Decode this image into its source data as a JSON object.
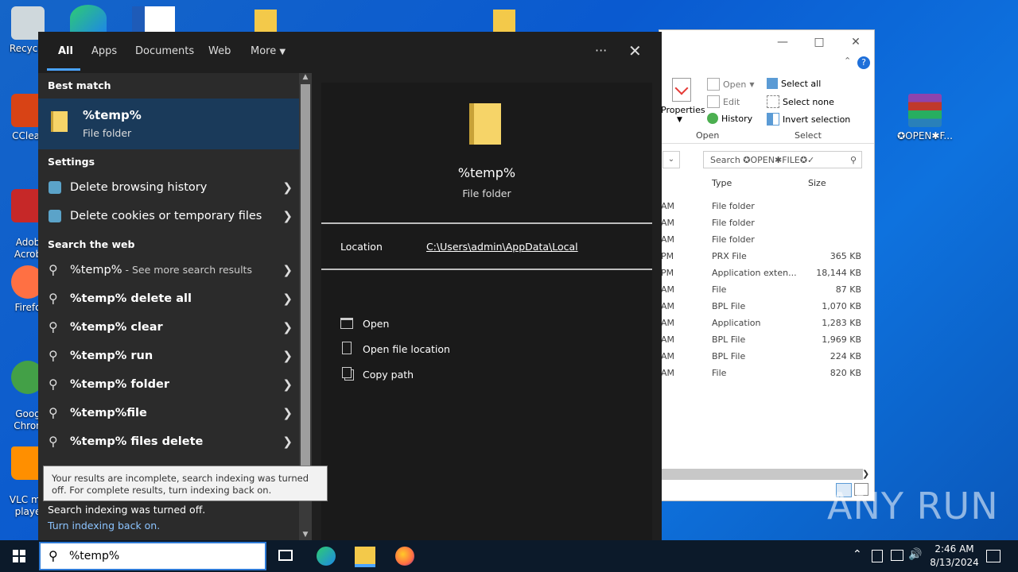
{
  "desktop": {
    "icons": [
      {
        "label": "Recycle",
        "color": "#cfd8dc"
      },
      {
        "label": "CClear",
        "color": "#d84315"
      },
      {
        "label": "Adob\nAcrob",
        "color": "#c62828"
      },
      {
        "label": "Firefo",
        "color": "#ff7043"
      },
      {
        "label": "Goog\nChron",
        "color": "#43a047"
      },
      {
        "label": "VLC me\nplaye",
        "color": "#ff8f00"
      }
    ],
    "right_icon_label": "✪OPEN✱F..."
  },
  "explorer": {
    "ribbon": {
      "properties": "Properties",
      "open": "Open",
      "edit": "Edit",
      "history": "History",
      "select_all": "Select all",
      "select_none": "Select none",
      "invert_selection": "Invert selection",
      "group_open": "Open",
      "group_select": "Select"
    },
    "search_placeholder": "Search ✪OPEN✱FILE✪✓",
    "columns": {
      "type": "Type",
      "size": "Size"
    },
    "rows": [
      {
        "date": "AM",
        "type": "File folder",
        "size": ""
      },
      {
        "date": "AM",
        "type": "File folder",
        "size": ""
      },
      {
        "date": "AM",
        "type": "File folder",
        "size": ""
      },
      {
        "date": "PM",
        "type": "PRX File",
        "size": "365 KB"
      },
      {
        "date": "PM",
        "type": "Application exten...",
        "size": "18,144 KB"
      },
      {
        "date": "AM",
        "type": "File",
        "size": "87 KB"
      },
      {
        "date": "AM",
        "type": "BPL File",
        "size": "1,070 KB"
      },
      {
        "date": "AM",
        "type": "Application",
        "size": "1,283 KB"
      },
      {
        "date": "AM",
        "type": "BPL File",
        "size": "1,969 KB"
      },
      {
        "date": "AM",
        "type": "BPL File",
        "size": "224 KB"
      },
      {
        "date": "AM",
        "type": "File",
        "size": "820 KB"
      }
    ]
  },
  "search": {
    "tabs": [
      "All",
      "Apps",
      "Documents",
      "Web",
      "More"
    ],
    "best_match_header": "Best match",
    "best_match": {
      "title": "%temp%",
      "subtitle": "File folder"
    },
    "settings_header": "Settings",
    "settings_items": [
      "Delete browsing history",
      "Delete cookies or temporary files"
    ],
    "web_header": "Search the web",
    "web_first": {
      "bold": "%temp%",
      "rest": " - See more search results"
    },
    "web_items": [
      "%temp% delete all",
      "%temp% clear",
      "%temp% run",
      "%temp% folder",
      "%temp%file",
      "%temp% files delete"
    ],
    "tooltip": "Your results are incomplete, search indexing was turned off. For complete results, turn indexing back on.",
    "indexing_off": "Search indexing was turned off.",
    "turn_on_link": "Turn indexing back on.",
    "detail": {
      "title": "%temp%",
      "subtitle": "File folder",
      "location_label": "Location",
      "location_value": "C:\\Users\\admin\\AppData\\Local",
      "actions": [
        "Open",
        "Open file location",
        "Copy path"
      ]
    }
  },
  "taskbar": {
    "search_text": "%temp%",
    "time": "2:46 AM",
    "date": "8/13/2024"
  },
  "watermark": "ANY  RUN"
}
